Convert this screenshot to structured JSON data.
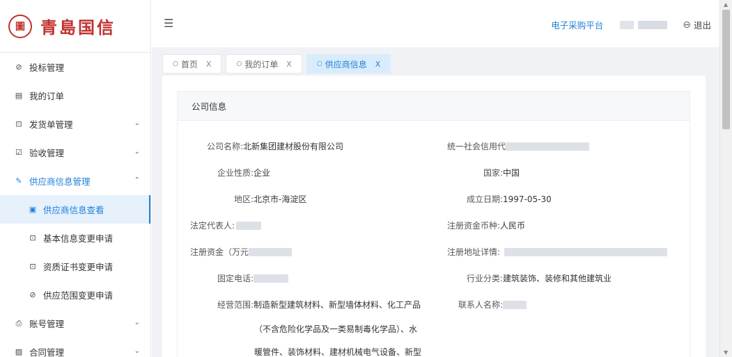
{
  "brand": {
    "logo_glyph": "圖",
    "name": "青島国信",
    "color": "#c0302e"
  },
  "sidebar": {
    "items": [
      {
        "label": "投标管理",
        "icon": "check-circle-icon",
        "glyph": "⊘",
        "chevron": ""
      },
      {
        "label": "我的订单",
        "icon": "order-icon",
        "glyph": "▤",
        "chevron": ""
      },
      {
        "label": "发货单管理",
        "icon": "shipment-icon",
        "glyph": "⊡",
        "chevron": "⌄"
      },
      {
        "label": "验收管理",
        "icon": "checkbox-icon",
        "glyph": "☑",
        "chevron": "⌄"
      },
      {
        "label": "供应商信息管理",
        "icon": "pen-icon",
        "glyph": "✎",
        "chevron": "⌃"
      },
      {
        "label": "供应商信息查看",
        "icon": "document-icon",
        "glyph": "▣",
        "chevron": ""
      },
      {
        "label": "基本信息变更申请",
        "icon": "form-icon",
        "glyph": "⊡",
        "chevron": ""
      },
      {
        "label": "资质证书变更申请",
        "icon": "form-icon",
        "glyph": "⊡",
        "chevron": ""
      },
      {
        "label": "供应范围变更申请",
        "icon": "check-circle-icon",
        "glyph": "⊘",
        "chevron": ""
      },
      {
        "label": "账号管理",
        "icon": "account-icon",
        "glyph": "⎙",
        "chevron": "⌄"
      },
      {
        "label": "合同管理",
        "icon": "contract-icon",
        "glyph": "▨",
        "chevron": "⌄"
      }
    ]
  },
  "header": {
    "hamburger_glyph": "☰",
    "platform_link": "电子采购平台",
    "logout_glyph": "⊖",
    "logout_label": "退出"
  },
  "tabs": [
    {
      "label": "首页",
      "close": "X",
      "dot": "○"
    },
    {
      "label": "我的订单",
      "close": "X",
      "dot": "○"
    },
    {
      "label": "供应商信息",
      "close": "X",
      "dot": "○"
    }
  ],
  "card": {
    "title": "公司信息",
    "fields": {
      "company_name": {
        "label": "公司名称:",
        "value": "北新集团建材股份有限公司"
      },
      "credit_code": {
        "label": "统一社会信用代",
        "value": ""
      },
      "nature": {
        "label": "企业性质:",
        "value": "企业"
      },
      "country": {
        "label": "国家:",
        "value": "中国"
      },
      "region": {
        "label": "地区:",
        "value": "北京市-海淀区"
      },
      "founded": {
        "label": "成立日期:",
        "value": "1997-05-30"
      },
      "legal_rep": {
        "label": "法定代表人:",
        "value": ""
      },
      "capital_currency": {
        "label": "注册资金币种:",
        "value": "人民币"
      },
      "capital": {
        "label": "注册资金（万元",
        "value": ""
      },
      "address": {
        "label": "注册地址详情:",
        "value": ""
      },
      "phone": {
        "label": "固定电话:",
        "value": ""
      },
      "industry": {
        "label": "行业分类:",
        "value": "建筑装饰、装修和其他建筑业"
      },
      "scope": {
        "label": "经营范围:",
        "lines": [
          "制造新型建筑材料、新型墙体材料、化工产品",
          "（不含危险化学品及一类易制毒化学品）、水",
          "暖管件、装饰材料、建材机械电气设备、新型"
        ]
      },
      "contact": {
        "label": "联系人名称:",
        "value": ""
      }
    }
  },
  "scrollbar": {
    "up_glyph": "▲",
    "down_glyph": "▼"
  }
}
